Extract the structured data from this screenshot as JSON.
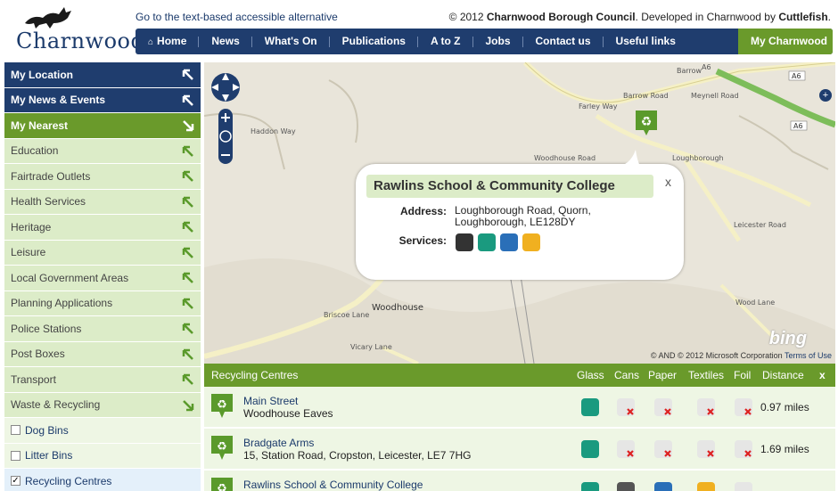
{
  "header": {
    "logo_text": "Charnwood",
    "accessible_link": "Go to the text-based accessible alternative",
    "credit_prefix": "© 2012",
    "credit_org": "Charnwood Borough Council",
    "credit_mid": ". Developed in Charnwood by",
    "credit_dev": "Cuttlefish",
    "credit_end": "."
  },
  "nav": {
    "items": [
      "Home",
      "News",
      "What's On",
      "Publications",
      "A to Z",
      "Jobs",
      "Contact us",
      "Useful links"
    ],
    "mine": "My Charnwood"
  },
  "sidebar": {
    "my_location": "My Location",
    "my_news": "My News & Events",
    "my_nearest": "My Nearest",
    "categories": [
      "Education",
      "Fairtrade Outlets",
      "Health Services",
      "Heritage",
      "Leisure",
      "Local Government Areas",
      "Planning Applications",
      "Police Stations",
      "Post Boxes",
      "Transport",
      "Waste & Recycling"
    ],
    "sub": [
      {
        "label": "Dog Bins",
        "checked": false
      },
      {
        "label": "Litter Bins",
        "checked": false
      },
      {
        "label": "Recycling Centres",
        "checked": true
      }
    ]
  },
  "map": {
    "roads": [
      "Barrow",
      "A6",
      "Meynell Road",
      "Farley Way",
      "Barrow Road",
      "Haddon Way",
      "Woodhouse Road",
      "Leicester Road",
      "Briscoe Lane",
      "Woodhouse",
      "Vicary Lane",
      "Wood Lane",
      "Loughborough",
      "Leicester Road",
      "Barrow Road"
    ],
    "copyright": "© AND © 2012 Microsoft Corporation",
    "terms": "Terms of Use",
    "brand": "bing"
  },
  "popup": {
    "title": "Rawlins School & Community College",
    "address_label": "Address:",
    "address_line1": "Loughborough Road, Quorn,",
    "address_line2": "Loughborough, LE128DY",
    "services_label": "Services:",
    "close": "x",
    "services": [
      "cans",
      "glass",
      "paper",
      "textiles"
    ]
  },
  "table": {
    "title": "Recycling Centres",
    "columns": [
      "Glass",
      "Cans",
      "Paper",
      "Textiles",
      "Foil",
      "Distance"
    ],
    "close": "x",
    "rows": [
      {
        "name": "Main Street",
        "address": "Woodhouse Eaves",
        "distance": "0.97 miles",
        "glass": true,
        "cans": false,
        "paper": false,
        "textiles": false,
        "foil": false
      },
      {
        "name": "Bradgate Arms",
        "address": "15, Station Road, Cropston, Leicester, LE7 7HG",
        "distance": "1.69 miles",
        "glass": true,
        "cans": false,
        "paper": false,
        "textiles": false,
        "foil": false
      },
      {
        "name": "Rawlins School & Community College",
        "address": "",
        "distance": "",
        "glass": true,
        "cans": true,
        "paper": true,
        "textiles": true,
        "foil": false
      }
    ]
  },
  "colors": {
    "navy": "#1f3d6e",
    "green": "#6a9a2b",
    "light_green": "#dcecc8",
    "teal": "#1a9a7f",
    "yellow": "#f0b020",
    "blue": "#2a6fb8"
  }
}
